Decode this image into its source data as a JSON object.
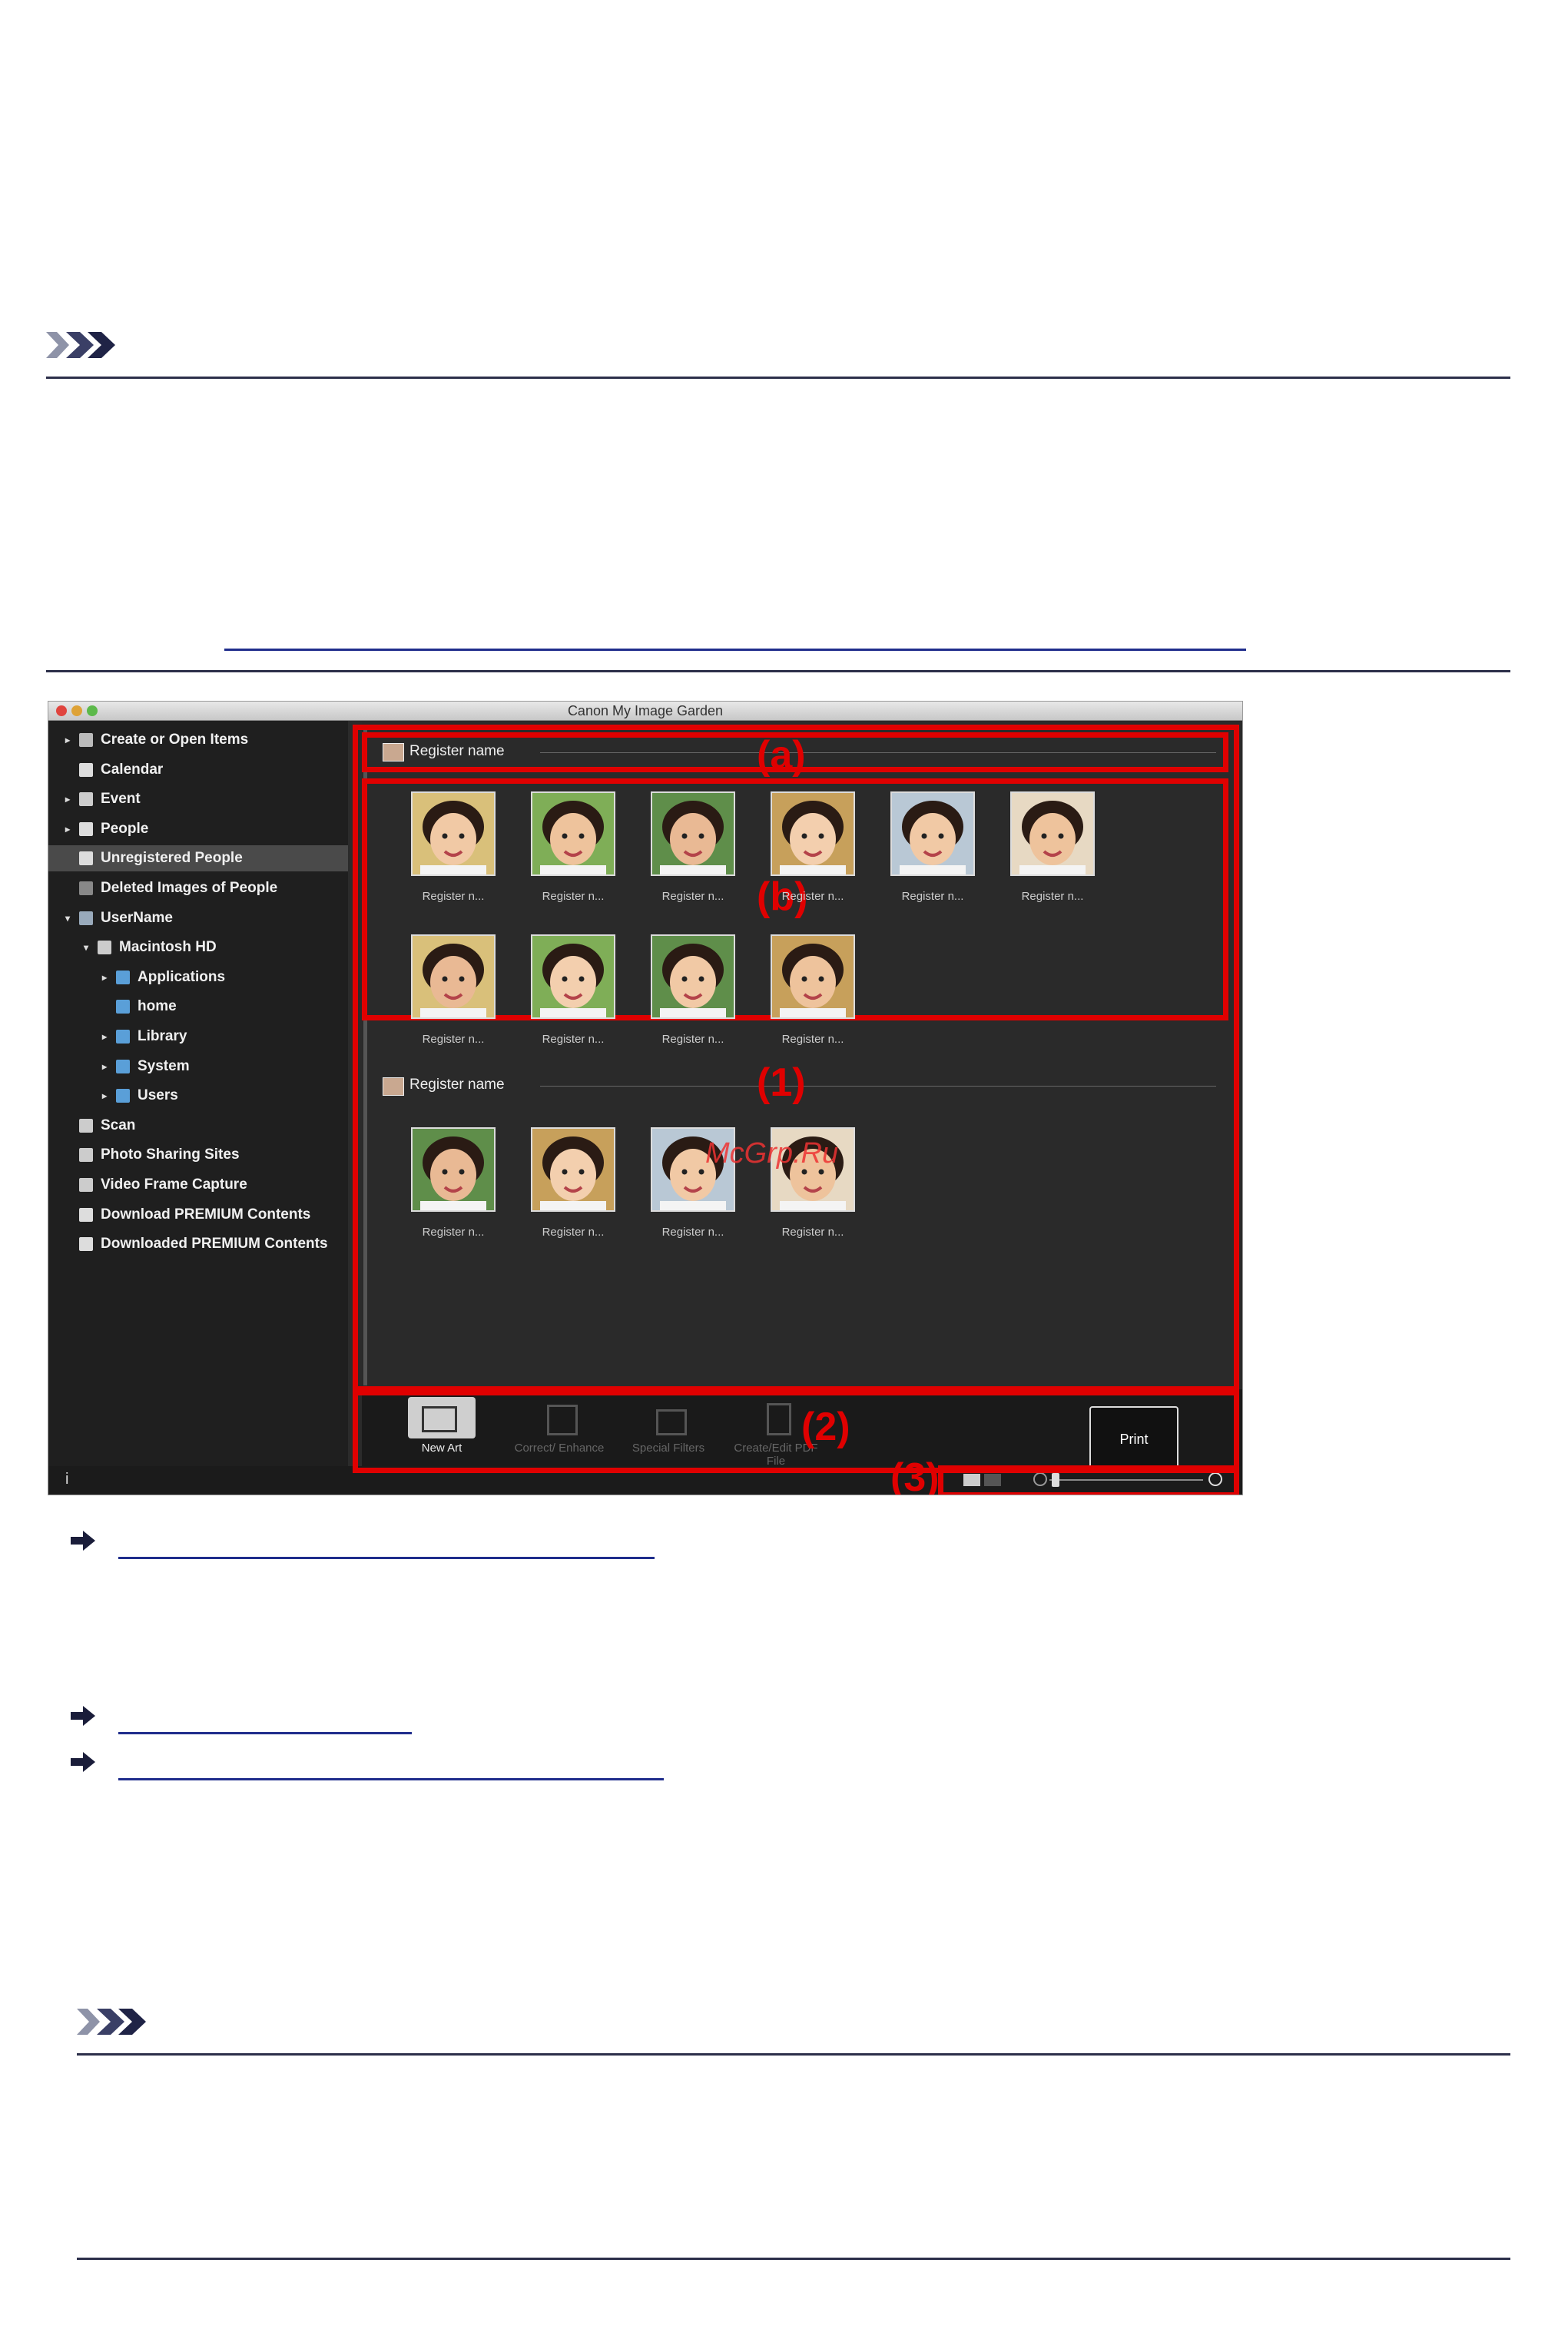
{
  "doc": {
    "note_icon": "note-chevrons-icon",
    "link_arrow_icon": "right-arrow-icon"
  },
  "window": {
    "title": "Canon My Image Garden",
    "sidebar": [
      {
        "label": "Create or Open Items",
        "icon": "create-icon",
        "expander": "▸"
      },
      {
        "label": "Calendar",
        "icon": "calendar-icon",
        "expander": ""
      },
      {
        "label": "Event",
        "icon": "event-icon",
        "expander": "▸"
      },
      {
        "label": "People",
        "icon": "people-icon",
        "expander": "▸"
      },
      {
        "label": "Unregistered People",
        "icon": "unregistered-people-icon",
        "expander": "",
        "selected": true
      },
      {
        "label": "Deleted Images of People",
        "icon": "deleted-people-icon",
        "expander": ""
      },
      {
        "label": "UserName",
        "icon": "computer-icon",
        "expander": "▾"
      },
      {
        "label": "Macintosh HD",
        "icon": "disk-icon",
        "expander": "▾"
      },
      {
        "label": "Applications",
        "icon": "folder-icon",
        "expander": "▸"
      },
      {
        "label": "home",
        "icon": "home-icon",
        "expander": ""
      },
      {
        "label": "Library",
        "icon": "folder-icon",
        "expander": "▸"
      },
      {
        "label": "System",
        "icon": "folder-icon",
        "expander": "▸"
      },
      {
        "label": "Users",
        "icon": "folder-icon",
        "expander": "▸"
      },
      {
        "label": "Scan",
        "icon": "scan-icon",
        "expander": ""
      },
      {
        "label": "Photo Sharing Sites",
        "icon": "photo-sharing-icon",
        "expander": ""
      },
      {
        "label": "Video Frame Capture",
        "icon": "video-icon",
        "expander": ""
      },
      {
        "label": "Download PREMIUM Contents",
        "icon": "download-icon",
        "expander": ""
      },
      {
        "label": "Downloaded PREMIUM Contents",
        "icon": "downloaded-icon",
        "expander": ""
      }
    ],
    "groups": [
      {
        "header": "Register name",
        "thumb_label": "Register n..."
      },
      {
        "header": "Register name",
        "thumb_label": "Register n..."
      }
    ],
    "toolbar": {
      "new_art": "New Art",
      "correct": "Correct/ Enhance",
      "special": "Special Filters",
      "pdf": "Create/Edit PDF File",
      "print": "Print"
    },
    "status": {
      "info": "i"
    }
  },
  "callouts": {
    "a": "(a)",
    "b": "(b)",
    "one": "(1)",
    "two": "(2)",
    "three": "(3)"
  },
  "watermark": "McGrp.Ru",
  "colors": {
    "callout_red": "#e00000",
    "rule": "#2c2f4a",
    "link": "#1f2d8c"
  }
}
